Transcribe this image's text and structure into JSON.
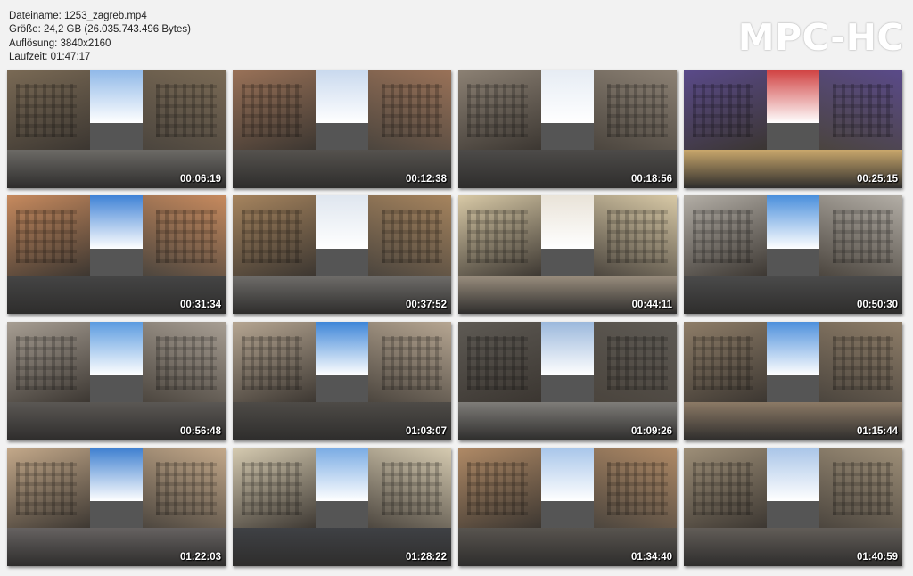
{
  "info": {
    "filename": "Dateiname: 1253_zagreb.mp4",
    "size": "Größe: 24,2 GB (26.035.743.496 Bytes)",
    "resolution": "Auflösung: 3840x2160",
    "duration": "Laufzeit: 01:47:17"
  },
  "logo": "MPC-HC",
  "thumbnails": [
    {
      "time": "00:06:19",
      "sky": "#8fb8e8",
      "wall": "#7a6a55",
      "road": "#6c6a66"
    },
    {
      "time": "00:12:38",
      "sky": "#c9d9ee",
      "wall": "#9a7258",
      "road": "#55524e"
    },
    {
      "time": "00:18:56",
      "sky": "#e6ecf4",
      "wall": "#8c8174",
      "road": "#4d4b49"
    },
    {
      "time": "00:25:15",
      "sky": "#d04040",
      "wall": "#5a4a8a",
      "road": "#c9a76c"
    },
    {
      "time": "00:31:34",
      "sky": "#3f82d6",
      "wall": "#c78a5e",
      "road": "#454545"
    },
    {
      "time": "00:37:52",
      "sky": "#dfe6ef",
      "wall": "#a6845e",
      "road": "#6f6d6a"
    },
    {
      "time": "00:44:11",
      "sky": "#e9e3d8",
      "wall": "#d8c9a6",
      "road": "#9a8e7e"
    },
    {
      "time": "00:50:30",
      "sky": "#4a8fdc",
      "wall": "#b3aea6",
      "road": "#4b4b4b"
    },
    {
      "time": "00:56:48",
      "sky": "#5b9be0",
      "wall": "#a79e93",
      "road": "#5b5854"
    },
    {
      "time": "01:03:07",
      "sky": "#3e86d8",
      "wall": "#b6a692",
      "road": "#4e4b47"
    },
    {
      "time": "01:09:26",
      "sky": "#9bb8dc",
      "wall": "#5e5a54",
      "road": "#7f7d79"
    },
    {
      "time": "01:15:44",
      "sky": "#4e90dc",
      "wall": "#8e7d68",
      "road": "#8c7a66"
    },
    {
      "time": "01:22:03",
      "sky": "#3d7fd0",
      "wall": "#c4a98a",
      "road": "#666261"
    },
    {
      "time": "01:28:22",
      "sky": "#79abe4",
      "wall": "#d6cbb1",
      "road": "#3f4145"
    },
    {
      "time": "01:34:40",
      "sky": "#a8c6ea",
      "wall": "#b08a66",
      "road": "#58544f"
    },
    {
      "time": "01:40:59",
      "sky": "#a9c5e8",
      "wall": "#9e8f78",
      "road": "#625d58"
    }
  ]
}
